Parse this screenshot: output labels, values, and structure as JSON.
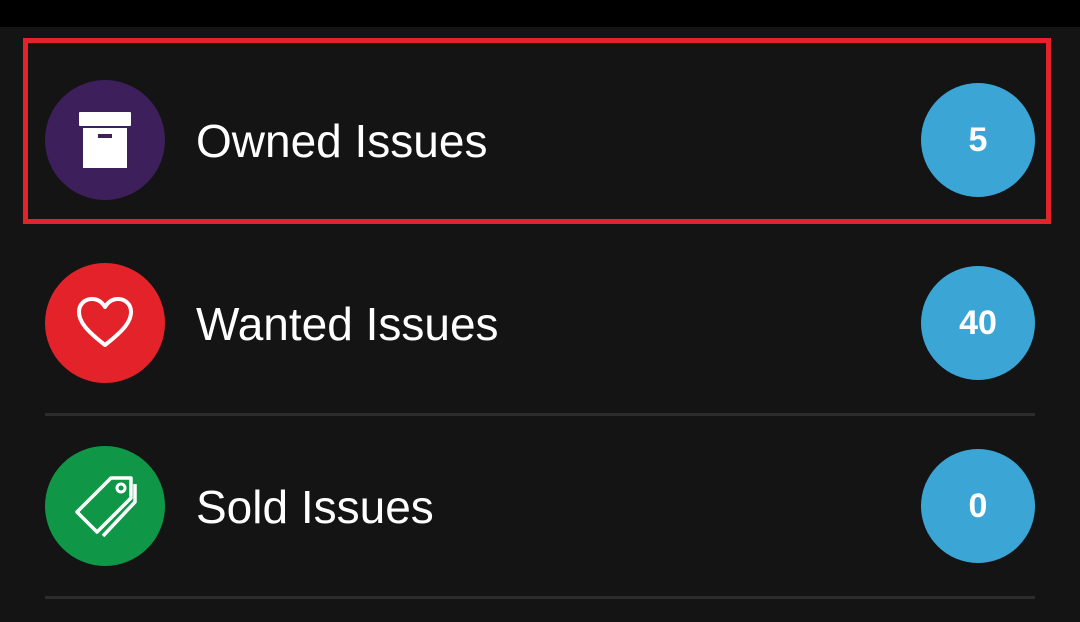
{
  "colors": {
    "background": "#141414",
    "topbar": "#000000",
    "badge": "#3ba6d6",
    "highlight_border": "#e3222a",
    "owned_icon_bg": "#3d1f5c",
    "wanted_icon_bg": "#e3222a",
    "sold_icon_bg": "#0f9647"
  },
  "items": [
    {
      "label": "Owned Issues",
      "count": "5",
      "icon": "archive-box-icon"
    },
    {
      "label": "Wanted Issues",
      "count": "40",
      "icon": "heart-icon"
    },
    {
      "label": "Sold Issues",
      "count": "0",
      "icon": "price-tag-icon"
    }
  ]
}
